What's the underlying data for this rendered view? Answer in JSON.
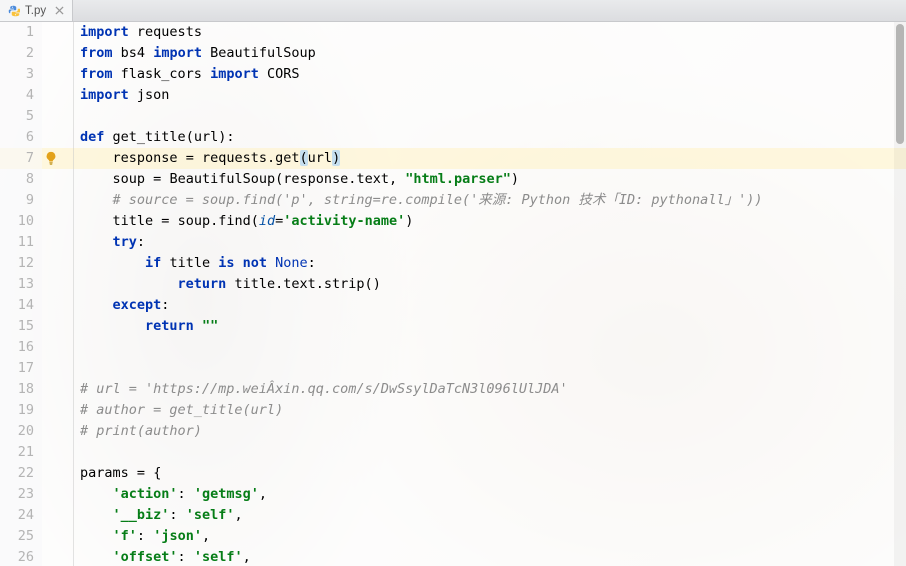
{
  "tab": {
    "filename": "T.py"
  },
  "gutter": {
    "start": 1,
    "end": 26
  },
  "highlighted_line": 7,
  "bulb_line": 7,
  "code": {
    "l1": {
      "pre": "",
      "tokens": [
        [
          "kw",
          "import"
        ],
        [
          "sp",
          " "
        ],
        [
          "mod",
          "requests"
        ]
      ]
    },
    "l2": {
      "pre": "",
      "tokens": [
        [
          "kw",
          "from"
        ],
        [
          "sp",
          " "
        ],
        [
          "mod",
          "bs4"
        ],
        [
          "sp",
          " "
        ],
        [
          "kw",
          "import"
        ],
        [
          "sp",
          " "
        ],
        [
          "id",
          "BeautifulSoup"
        ]
      ]
    },
    "l3": {
      "pre": "",
      "tokens": [
        [
          "kw",
          "from"
        ],
        [
          "sp",
          " "
        ],
        [
          "mod",
          "flask_cors"
        ],
        [
          "sp",
          " "
        ],
        [
          "kw",
          "import"
        ],
        [
          "sp",
          " "
        ],
        [
          "id",
          "CORS"
        ]
      ]
    },
    "l4": {
      "pre": "",
      "tokens": [
        [
          "kw",
          "import"
        ],
        [
          "sp",
          " "
        ],
        [
          "mod",
          "json"
        ]
      ]
    },
    "l5": {
      "pre": "",
      "tokens": []
    },
    "l6": {
      "pre": "",
      "tokens": [
        [
          "kw",
          "def"
        ],
        [
          "sp",
          " "
        ],
        [
          "fn",
          "get_title"
        ],
        [
          "punct",
          "("
        ],
        [
          "id",
          "url"
        ],
        [
          "punct",
          ")"
        ],
        [
          "punct",
          ":"
        ]
      ]
    },
    "l7": {
      "pre": "    ",
      "tokens": [
        [
          "id",
          "response"
        ],
        [
          "sp",
          " "
        ],
        [
          "op",
          "="
        ],
        [
          "sp",
          " "
        ],
        [
          "id",
          "requests"
        ],
        [
          "punct",
          "."
        ],
        [
          "id",
          "get"
        ],
        [
          "paren",
          "("
        ],
        [
          "id",
          "url"
        ],
        [
          "parenc",
          ")"
        ]
      ]
    },
    "l8": {
      "pre": "    ",
      "tokens": [
        [
          "id",
          "soup"
        ],
        [
          "sp",
          " "
        ],
        [
          "op",
          "="
        ],
        [
          "sp",
          " "
        ],
        [
          "id",
          "BeautifulSoup"
        ],
        [
          "punct",
          "("
        ],
        [
          "id",
          "response"
        ],
        [
          "punct",
          "."
        ],
        [
          "id",
          "text"
        ],
        [
          "punct",
          ","
        ],
        [
          "sp",
          " "
        ],
        [
          "str",
          "\"html.parser\""
        ],
        [
          "punct",
          ")"
        ]
      ]
    },
    "l9": {
      "pre": "    ",
      "tokens": [
        [
          "cmt",
          "# source = soup.find('p', string=re.compile('来源: Python 技术「ID: pythonall」'))"
        ]
      ]
    },
    "l10": {
      "pre": "    ",
      "tokens": [
        [
          "id",
          "title"
        ],
        [
          "sp",
          " "
        ],
        [
          "op",
          "="
        ],
        [
          "sp",
          " "
        ],
        [
          "id",
          "soup"
        ],
        [
          "punct",
          "."
        ],
        [
          "id",
          "find"
        ],
        [
          "punct",
          "("
        ],
        [
          "builtin",
          "id"
        ],
        [
          "op",
          "="
        ],
        [
          "str",
          "'activity-name'"
        ],
        [
          "punct",
          ")"
        ]
      ]
    },
    "l11": {
      "pre": "    ",
      "tokens": [
        [
          "kw",
          "try"
        ],
        [
          "punct",
          ":"
        ]
      ]
    },
    "l12": {
      "pre": "        ",
      "tokens": [
        [
          "kw",
          "if"
        ],
        [
          "sp",
          " "
        ],
        [
          "id",
          "title"
        ],
        [
          "sp",
          " "
        ],
        [
          "kw",
          "is not"
        ],
        [
          "sp",
          " "
        ],
        [
          "kw2",
          "None"
        ],
        [
          "punct",
          ":"
        ]
      ]
    },
    "l13": {
      "pre": "            ",
      "tokens": [
        [
          "kw",
          "return"
        ],
        [
          "sp",
          " "
        ],
        [
          "id",
          "title"
        ],
        [
          "punct",
          "."
        ],
        [
          "id",
          "text"
        ],
        [
          "punct",
          "."
        ],
        [
          "id",
          "strip"
        ],
        [
          "punct",
          "("
        ],
        [
          "punct",
          ")"
        ]
      ]
    },
    "l14": {
      "pre": "    ",
      "tokens": [
        [
          "kw",
          "except"
        ],
        [
          "punct",
          ":"
        ]
      ]
    },
    "l15": {
      "pre": "        ",
      "tokens": [
        [
          "kw",
          "return"
        ],
        [
          "sp",
          " "
        ],
        [
          "str",
          "\"\""
        ]
      ]
    },
    "l16": {
      "pre": "",
      "tokens": []
    },
    "l17": {
      "pre": "",
      "tokens": []
    },
    "l18": {
      "pre": "",
      "tokens": [
        [
          "cmt",
          "# url = 'https://mp.weiÂxin.qq.com/s/DwSsylDaTcN3l096lUlJDA'"
        ]
      ]
    },
    "l19": {
      "pre": "",
      "tokens": [
        [
          "cmt",
          "# author = get_title(url)"
        ]
      ]
    },
    "l20": {
      "pre": "",
      "tokens": [
        [
          "cmt",
          "# print(author)"
        ]
      ]
    },
    "l21": {
      "pre": "",
      "tokens": []
    },
    "l22": {
      "pre": "",
      "tokens": [
        [
          "id",
          "params"
        ],
        [
          "sp",
          " "
        ],
        [
          "op",
          "="
        ],
        [
          "sp",
          " "
        ],
        [
          "punct",
          "{"
        ]
      ]
    },
    "l23": {
      "pre": "    ",
      "tokens": [
        [
          "str",
          "'action'"
        ],
        [
          "punct",
          ":"
        ],
        [
          "sp",
          " "
        ],
        [
          "str",
          "'getmsg'"
        ],
        [
          "punct",
          ","
        ]
      ]
    },
    "l24": {
      "pre": "    ",
      "tokens": [
        [
          "str",
          "'__biz'"
        ],
        [
          "punct",
          ":"
        ],
        [
          "sp",
          " "
        ],
        [
          "str",
          "'self'"
        ],
        [
          "punct",
          ","
        ]
      ]
    },
    "l25": {
      "pre": "    ",
      "tokens": [
        [
          "str",
          "'f'"
        ],
        [
          "punct",
          ":"
        ],
        [
          "sp",
          " "
        ],
        [
          "str",
          "'json'"
        ],
        [
          "punct",
          ","
        ]
      ]
    },
    "l26": {
      "pre": "    ",
      "tokens": [
        [
          "str",
          "'offset'"
        ],
        [
          "punct",
          ":"
        ],
        [
          "sp",
          " "
        ],
        [
          "str",
          "'self'"
        ],
        [
          "punct",
          ","
        ]
      ]
    }
  }
}
